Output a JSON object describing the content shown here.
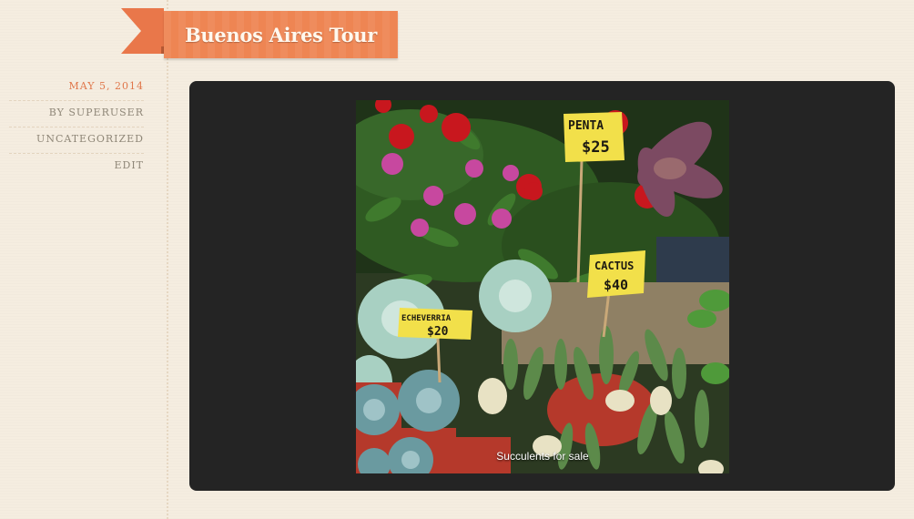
{
  "post": {
    "title": "Buenos Aires Tour"
  },
  "meta": {
    "date": "MAY 5, 2014",
    "author": "BY SUPERUSER",
    "category": "UNCATEGORIZED",
    "edit": "EDIT"
  },
  "gallery": {
    "caption": "Succulents for sale",
    "signs": {
      "penta_name": "PENTA",
      "penta_price": "$25",
      "cactus_name": "CACTUS",
      "cactus_price": "$40",
      "echeverria_name": "ECHEVERRIA",
      "echeverria_price": "$20"
    }
  },
  "colors": {
    "background": "#f5ede0",
    "ribbon": "#ee8553",
    "accent": "#e0764a",
    "panel": "#242424"
  }
}
